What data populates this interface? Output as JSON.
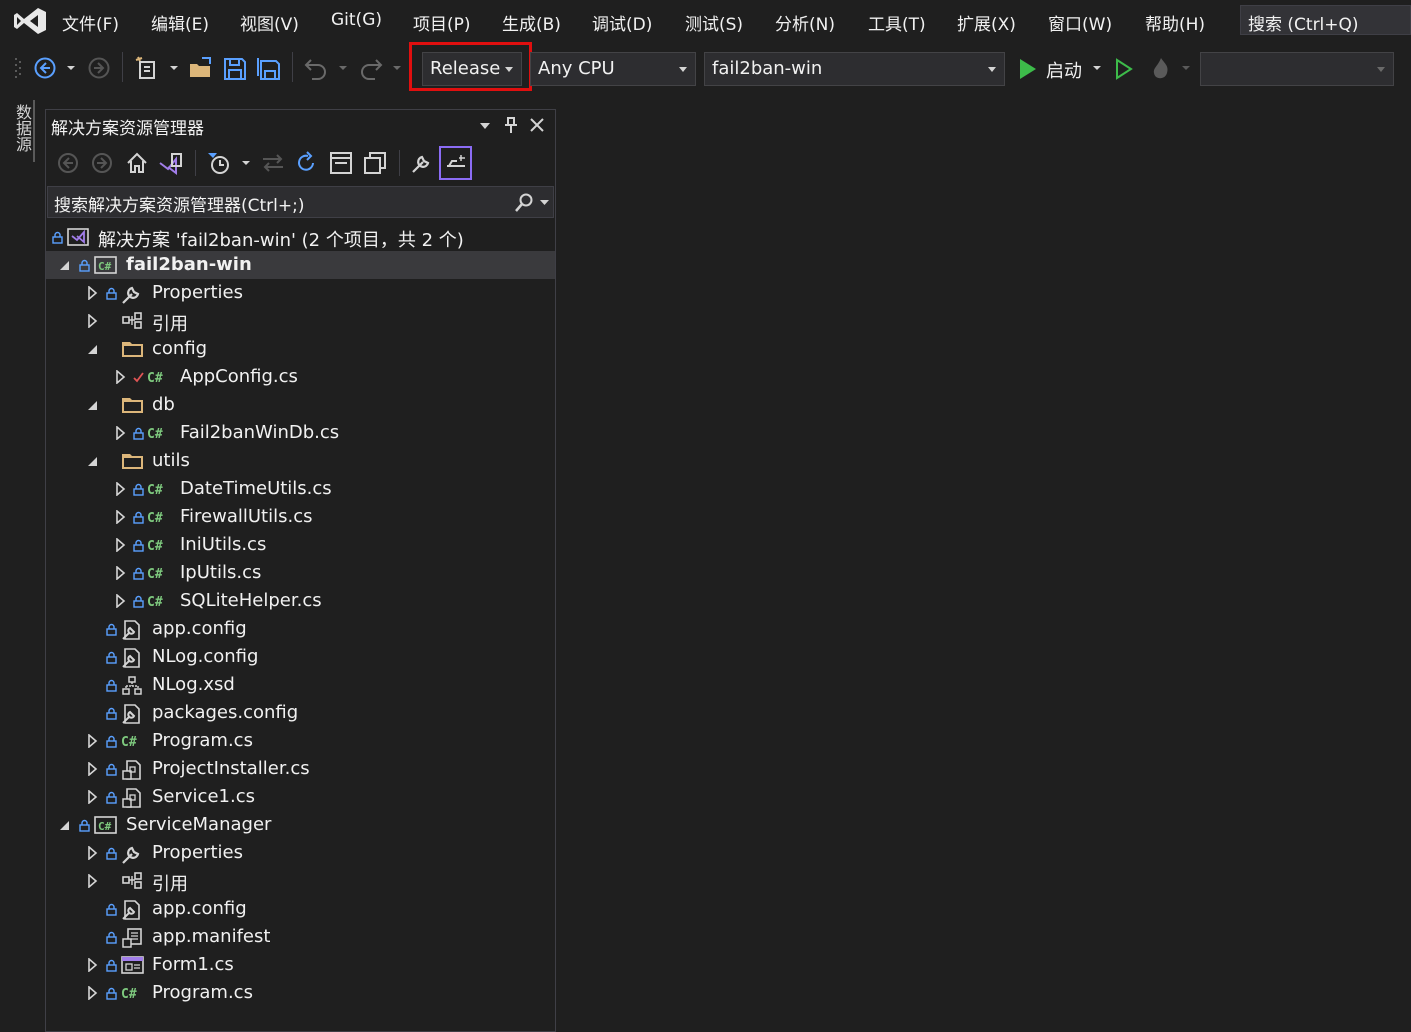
{
  "menu": [
    "文件(F)",
    "编辑(E)",
    "视图(V)",
    "Git(G)",
    "项目(P)",
    "生成(B)",
    "调试(D)",
    "测试(S)",
    "分析(N)",
    "工具(T)",
    "扩展(X)",
    "窗口(W)",
    "帮助(H)"
  ],
  "search_placeholder": "搜索 (Ctrl+Q)",
  "toolbar": {
    "configuration": "Release",
    "platform": "Any CPU",
    "startup_project": "fail2ban-win",
    "start_label": "启动",
    "debug_target": ""
  },
  "side_tab": "数据源",
  "solution_explorer": {
    "title": "解决方案资源管理器",
    "search_placeholder": "搜索解决方案资源管理器(Ctrl+;)",
    "tree": [
      {
        "label": "解决方案 'fail2ban-win' (2 个项目，共 2 个)",
        "icon": "solution-icon"
      },
      {
        "label": "fail2ban-win",
        "icon": "csproj-icon",
        "expanded": true,
        "bold": true,
        "selected": true
      },
      {
        "label": "Properties",
        "icon": "wrench-icon",
        "expanded": false
      },
      {
        "label": "引用",
        "icon": "references-icon",
        "expanded": false
      },
      {
        "label": "config",
        "icon": "folder-icon",
        "expanded": true
      },
      {
        "label": "AppConfig.cs",
        "icon": "csharp-file-icon",
        "expanded": false,
        "status": "checkmark"
      },
      {
        "label": "db",
        "icon": "folder-icon",
        "expanded": true
      },
      {
        "label": "Fail2banWinDb.cs",
        "icon": "csharp-file-icon",
        "expanded": false
      },
      {
        "label": "utils",
        "icon": "folder-icon",
        "expanded": true
      },
      {
        "label": "DateTimeUtils.cs",
        "icon": "csharp-file-icon",
        "expanded": false
      },
      {
        "label": "FirewallUtils.cs",
        "icon": "csharp-file-icon",
        "expanded": false
      },
      {
        "label": "IniUtils.cs",
        "icon": "csharp-file-icon",
        "expanded": false
      },
      {
        "label": "IpUtils.cs",
        "icon": "csharp-file-icon",
        "expanded": false
      },
      {
        "label": "SQLiteHelper.cs",
        "icon": "csharp-file-icon",
        "expanded": false
      },
      {
        "label": "app.config",
        "icon": "config-file-icon"
      },
      {
        "label": "NLog.config",
        "icon": "config-file-icon"
      },
      {
        "label": "NLog.xsd",
        "icon": "xsd-file-icon"
      },
      {
        "label": "packages.config",
        "icon": "config-file-icon"
      },
      {
        "label": "Program.cs",
        "icon": "csharp-file-icon",
        "expanded": false
      },
      {
        "label": "ProjectInstaller.cs",
        "icon": "component-file-icon",
        "expanded": false
      },
      {
        "label": "Service1.cs",
        "icon": "component-file-icon",
        "expanded": false
      },
      {
        "label": "ServiceManager",
        "icon": "csproj-icon",
        "expanded": true
      },
      {
        "label": "Properties",
        "icon": "wrench-icon",
        "expanded": false
      },
      {
        "label": "引用",
        "icon": "references-icon",
        "expanded": false
      },
      {
        "label": "app.config",
        "icon": "config-file-icon"
      },
      {
        "label": "app.manifest",
        "icon": "manifest-file-icon"
      },
      {
        "label": "Form1.cs",
        "icon": "form-file-icon",
        "expanded": false
      },
      {
        "label": "Program.cs",
        "icon": "csharp-file-icon",
        "expanded": false
      }
    ]
  },
  "colors": {
    "background": "#1f1f1f",
    "highlight": "#e00f0f",
    "play_green": "#3dbb4a",
    "accent_purple": "#8b6cf5",
    "csharp_green": "#7ec97e",
    "folder_yellow": "#dcb67a"
  }
}
